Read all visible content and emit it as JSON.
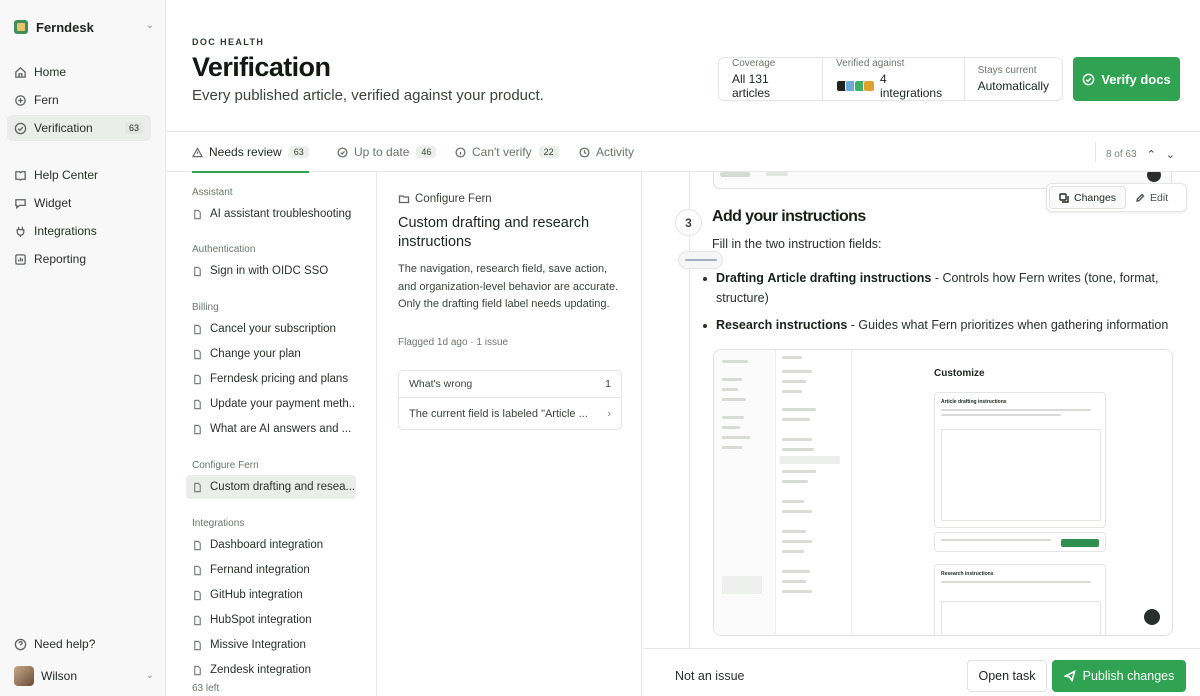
{
  "sidebar": {
    "workspace": "Ferndesk",
    "nav": [
      {
        "label": "Home"
      },
      {
        "label": "Fern"
      },
      {
        "label": "Verification",
        "count": "63"
      }
    ],
    "nav2": [
      {
        "label": "Help Center"
      },
      {
        "label": "Widget"
      },
      {
        "label": "Integrations"
      },
      {
        "label": "Reporting"
      }
    ],
    "need_help": "Need help?",
    "user": "Wilson"
  },
  "header": {
    "kicker": "DOC HEALTH",
    "title": "Verification",
    "subtitle": "Every published article, verified against your product.",
    "stats": [
      {
        "key": "Coverage",
        "value": "All 131 articles"
      },
      {
        "key": "Verified against",
        "value": "4 integrations"
      },
      {
        "key": "Stays current",
        "value": "Automatically"
      }
    ],
    "verify_label": "Verify docs"
  },
  "tabs": [
    {
      "label": "Needs review",
      "count": "63"
    },
    {
      "label": "Up to date",
      "count": "46"
    },
    {
      "label": "Can't verify",
      "count": "22"
    },
    {
      "label": "Activity"
    }
  ],
  "pager": "8 of 63",
  "articles": {
    "groups": [
      {
        "name": "Assistant",
        "items": [
          "AI assistant troubleshooting"
        ]
      },
      {
        "name": "Authentication",
        "items": [
          "Sign in with OIDC SSO"
        ]
      },
      {
        "name": "Billing",
        "items": [
          "Cancel your subscription",
          "Change your plan",
          "Ferndesk pricing and plans",
          "Update your payment meth...",
          "What are AI answers and ..."
        ]
      },
      {
        "name": "Configure Fern",
        "items": [
          "Custom drafting and resea..."
        ]
      },
      {
        "name": "Integrations",
        "items": [
          "Dashboard integration",
          "Fernand integration",
          "GitHub integration",
          "HubSpot integration",
          "Missive Integration",
          "Zendesk integration"
        ]
      }
    ],
    "left": "63 left"
  },
  "detail": {
    "crumb": "Configure Fern",
    "title": "Custom drafting and research instructions",
    "description": "The navigation, research field, save action, and organization-level behavior are accurate. Only the drafting field label needs updating.",
    "flagged": "Flagged 1d ago · 1 issue",
    "whats_wrong": "What's wrong",
    "wrong_count": "1",
    "issue": "The current field is labeled \"Article ..."
  },
  "preview": {
    "toolbar": {
      "changes": "Changes",
      "edit": "Edit"
    },
    "step": "3",
    "heading": "Add your instructions",
    "intro": "Fill in the two instruction fields:",
    "bullet1_a": "Drafting",
    "bullet1_b": "Article drafting",
    "bullet1_c": "instructions",
    "bullet1_d": " - Controls how Fern writes (tone, format, structure)",
    "bullet2_a": "Research instructions",
    "bullet2_b": " - Guides what Fern prioritizes when gathering information",
    "screenshot": {
      "title": "Customize",
      "card1": "Article drafting instructions",
      "card2": "Research instructions"
    }
  },
  "actions": {
    "not_issue": "Not an issue",
    "open_task": "Open task",
    "publish": "Publish changes"
  },
  "colors": {
    "accent": "#2fa352",
    "integration_icons": [
      "#1f2420",
      "#6aa9d8",
      "#3fb06a",
      "#e0a030"
    ]
  }
}
